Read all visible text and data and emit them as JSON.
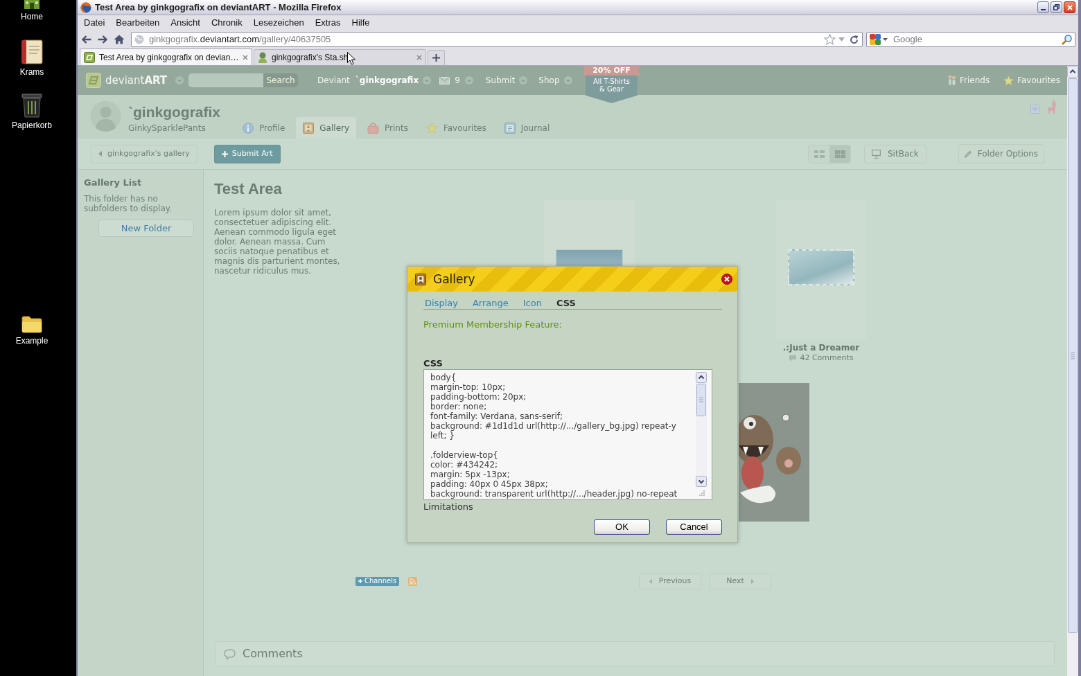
{
  "desktop": {
    "icons": [
      {
        "kind": "home",
        "label": "Home"
      },
      {
        "kind": "notebook",
        "label": "Krams"
      },
      {
        "kind": "trash",
        "label": "Papierkorb"
      },
      {
        "kind": "folder",
        "label": "Example"
      }
    ]
  },
  "browser": {
    "title": "Test Area by ginkgografix on deviantART - Mozilla Firefox",
    "menu": [
      "Datei",
      "Bearbeiten",
      "Ansicht",
      "Chronik",
      "Lesezeichen",
      "Extras",
      "Hilfe"
    ],
    "url": {
      "subdomain": "ginkgografix.",
      "domain": "deviantart.com",
      "path": "/gallery/40637505"
    },
    "search": {
      "placeholder": "Google"
    },
    "tabs": [
      {
        "kind": "site",
        "label": "Test Area by ginkgografix on devian…",
        "selected": true
      },
      {
        "kind": "avatar",
        "label": "ginkgografix's Sta.sh",
        "selected": false
      }
    ]
  },
  "site_header": {
    "logo": "deviant**ART**",
    "search_button": "Search",
    "deviant_label": "Deviant",
    "deviant_name": "`ginkgografix",
    "messages": "9",
    "submit": "Submit",
    "shop": "Shop",
    "promo": {
      "headline": "20% OFF",
      "lines": [
        "All T-Shirts",
        "& Gear"
      ]
    },
    "links": [
      {
        "kind": "friends",
        "label": "Friends"
      },
      {
        "kind": "star",
        "label": "Favourites"
      }
    ]
  },
  "profile": {
    "name": "`ginkgografix",
    "tagline": "GinkySparklePants",
    "tabs": [
      {
        "kind": "info",
        "label": "Profile",
        "selected": false
      },
      {
        "kind": "gallery",
        "label": "Gallery",
        "selected": true
      },
      {
        "kind": "prints",
        "label": "Prints",
        "selected": false
      },
      {
        "kind": "star",
        "label": "Favourites",
        "selected": false
      },
      {
        "kind": "journal",
        "label": "Journal",
        "selected": false
      }
    ]
  },
  "toolbar": {
    "back": "ginkgografix's gallery",
    "submit": "Submit Art",
    "view_modes": [
      {
        "kind": "list",
        "selected": false
      },
      {
        "kind": "grid",
        "selected": true
      }
    ],
    "sitback": "SitBack",
    "folder_options": "Folder Options"
  },
  "sidebar": {
    "title": "Gallery List",
    "empty_note": "This folder has no subfolders to display.",
    "button": "New Folder"
  },
  "gallery": {
    "title": "Test Area",
    "description": "Lorem ipsum dolor sit amet, consectetuer adipiscing elit. Aenean commodo ligula eget dolor. Aenean massa. Cum sociis natoque penatibus et magnis dis parturient montes, nascetur ridiculus mus.",
    "items": [
      {
        "kind": "landscape"
      },
      {
        "kind": "stamp",
        "title": ".:Just a Dreamer",
        "comments": "42 Comments"
      },
      {
        "kind": "illustration"
      }
    ],
    "channels": "Channels",
    "pager": [
      {
        "label": "Previous",
        "disabled": true
      },
      {
        "label": "Next",
        "disabled": true
      }
    ],
    "comments": "Comments"
  },
  "dialog": {
    "title": "Gallery",
    "tabs": [
      {
        "label": "Display",
        "selected": false
      },
      {
        "label": "Arrange",
        "selected": false
      },
      {
        "label": "Icon",
        "selected": false
      },
      {
        "label": "CSS",
        "selected": true
      }
    ],
    "premium_note": "Premium Membership Feature:",
    "css_label": "CSS",
    "css_blocks": [
      [
        "body{",
        "margin-top: 10px;",
        "padding-bottom: 20px;",
        "border: none;",
        "font-family: Verdana, sans-serif;",
        "background: #1d1d1d url(http://.../gallery_bg.jpg) repeat-y",
        "left; }"
      ],
      [
        ".folderview-top{",
        "color: #434242;",
        "margin: 5px -13px;",
        "padding: 40px 0 45px 38px;",
        "background: transparent url(http://.../header.jpg) no-repeat"
      ]
    ],
    "limitations": "Limitations",
    "buttons": [
      "OK",
      "Cancel"
    ]
  }
}
